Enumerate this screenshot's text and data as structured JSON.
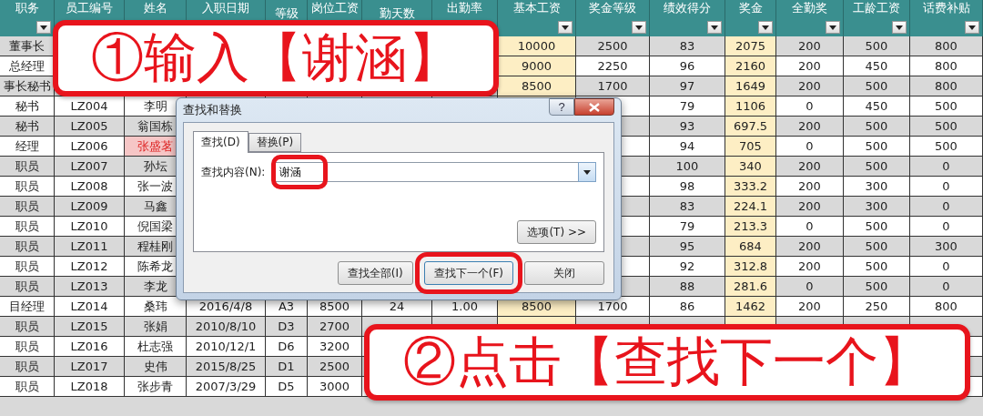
{
  "sheet": {
    "columns": [
      {
        "label": "职务",
        "filter": true
      },
      {
        "label": "员工编号",
        "filter": false
      },
      {
        "label": "姓名",
        "filter": false
      },
      {
        "label": "入职日期",
        "filter": false
      },
      {
        "label": "等级",
        "filter": false
      },
      {
        "label": "岗位工资",
        "filter": false
      },
      {
        "label": "勤天数",
        "filter": false
      },
      {
        "label": "出勤率",
        "filter": false
      },
      {
        "label": "基本工资",
        "filter": true
      },
      {
        "label": "奖金等级",
        "filter": true
      },
      {
        "label": "绩效得分",
        "filter": true
      },
      {
        "label": "奖金",
        "filter": true
      },
      {
        "label": "全勤奖",
        "filter": true
      },
      {
        "label": "工龄工资",
        "filter": true
      },
      {
        "label": "话费补贴",
        "filter": true
      }
    ],
    "rows": [
      {
        "cells": [
          "董事长",
          null,
          null,
          null,
          null,
          null,
          null,
          null,
          "10000",
          "2500",
          "83",
          "2075",
          "200",
          "500",
          "800"
        ]
      },
      {
        "cells": [
          "总经理",
          null,
          null,
          null,
          null,
          null,
          null,
          null,
          "9000",
          "2250",
          "96",
          "2160",
          "200",
          "450",
          "800"
        ]
      },
      {
        "cells": [
          "事长秘书",
          null,
          null,
          null,
          null,
          null,
          null,
          null,
          "8500",
          "1700",
          "97",
          "1649",
          "200",
          "500",
          "800"
        ]
      },
      {
        "cells": [
          "秘书",
          "LZ004",
          "李明",
          null,
          null,
          null,
          null,
          null,
          null,
          null,
          "79",
          "1106",
          "0",
          "450",
          "500"
        ]
      },
      {
        "cells": [
          "秘书",
          "LZ005",
          "翁国栋",
          null,
          null,
          null,
          null,
          null,
          null,
          null,
          "93",
          "697.5",
          "200",
          "500",
          "500"
        ]
      },
      {
        "cells": [
          "经理",
          "LZ006",
          {
            "text": "张盛茗",
            "highlighted": true
          },
          null,
          null,
          null,
          null,
          null,
          null,
          null,
          "94",
          "705",
          "0",
          "500",
          "500"
        ]
      },
      {
        "cells": [
          "职员",
          "LZ007",
          "孙坛",
          null,
          null,
          null,
          null,
          null,
          null,
          null,
          "100",
          "340",
          "200",
          "500",
          "0"
        ]
      },
      {
        "cells": [
          "职员",
          "LZ008",
          "张一波",
          null,
          null,
          null,
          null,
          null,
          null,
          null,
          "98",
          "333.2",
          "200",
          "300",
          "0"
        ]
      },
      {
        "cells": [
          "职员",
          "LZ009",
          "马鑫",
          null,
          null,
          null,
          null,
          null,
          null,
          null,
          "83",
          "224.1",
          "200",
          "300",
          "0"
        ]
      },
      {
        "cells": [
          "职员",
          "LZ010",
          "倪国梁",
          null,
          null,
          null,
          null,
          null,
          null,
          null,
          "79",
          "213.3",
          "0",
          "500",
          "0"
        ]
      },
      {
        "cells": [
          "职员",
          "LZ011",
          "程桂刚",
          null,
          null,
          null,
          null,
          null,
          null,
          null,
          "95",
          "684",
          "200",
          "500",
          "300"
        ]
      },
      {
        "cells": [
          "职员",
          "LZ012",
          "陈希龙",
          null,
          null,
          null,
          null,
          null,
          null,
          null,
          "92",
          "312.8",
          "200",
          "500",
          "0"
        ]
      },
      {
        "cells": [
          "职员",
          "LZ013",
          "李龙",
          null,
          null,
          null,
          null,
          null,
          null,
          null,
          "88",
          "281.6",
          "0",
          "500",
          "0"
        ]
      },
      {
        "cells": [
          "目经理",
          "LZ014",
          "桑玮",
          "2016/4/8",
          "A3",
          "8500",
          "24",
          "1.00",
          "8500",
          "1700",
          "86",
          "1462",
          "200",
          "250",
          "800"
        ]
      },
      {
        "cells": [
          "职员",
          "LZ015",
          "张娟",
          "2010/8/10",
          "D3",
          "2700",
          null,
          null,
          null,
          null,
          null,
          null,
          null,
          null,
          null
        ]
      },
      {
        "cells": [
          "职员",
          "LZ016",
          "杜志强",
          "2010/12/1",
          "D6",
          "3200",
          null,
          null,
          null,
          null,
          null,
          null,
          null,
          null,
          null
        ]
      },
      {
        "cells": [
          "职员",
          "LZ017",
          "史伟",
          "2015/8/25",
          "D1",
          "2500",
          null,
          null,
          null,
          null,
          null,
          null,
          null,
          null,
          null
        ]
      },
      {
        "cells": [
          "职员",
          "LZ018",
          "张步青",
          "2007/3/29",
          "D5",
          "3000",
          null,
          null,
          null,
          null,
          null,
          null,
          null,
          null,
          null
        ]
      }
    ]
  },
  "callouts": [
    "①输入【谢涵】",
    "②点击【查找下一个】"
  ],
  "dialog": {
    "title": "查找和替换",
    "help_button": "?",
    "tabs": [
      {
        "label": "查找(D)",
        "selected": true
      },
      {
        "label": "替换(P)",
        "selected": false
      }
    ],
    "find_label": "查找内容(N):",
    "find_value": "谢涵",
    "find_highlighted": true,
    "options_button": "选项(T) >>",
    "buttons": [
      {
        "label": "查找全部(I)",
        "highlighted": false
      },
      {
        "label": "查找下一个(F)",
        "highlighted": true
      },
      {
        "label": "关闭",
        "highlighted": false
      }
    ]
  }
}
